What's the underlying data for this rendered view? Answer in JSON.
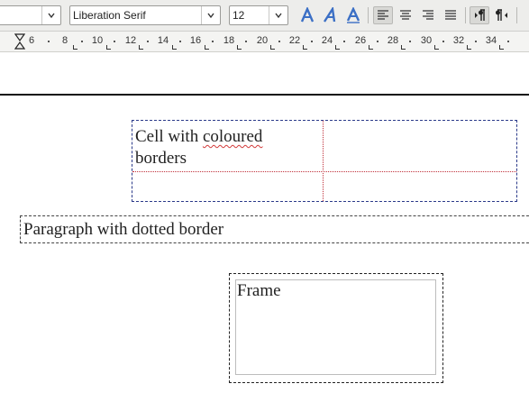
{
  "toolbar": {
    "paragraph_style": "",
    "font_name": "Liberation Serif",
    "font_size": "12",
    "icons": [
      "fontwork-icon",
      "fontwork-alt-icon",
      "fontwork-shadow-icon",
      "align-left-icon",
      "align-center-icon",
      "align-right-icon",
      "justify-icon",
      "ltr-text-direction-icon",
      "rtl-text-direction-icon"
    ],
    "colors": {
      "bg": "#ededeb",
      "icon_blue": "#3b6fc5"
    }
  },
  "ruler": {
    "marks": [
      "6",
      "8",
      "10",
      "12",
      "14",
      "16",
      "18",
      "20",
      "22",
      "24",
      "26",
      "28",
      "30",
      "32",
      "34"
    ]
  },
  "document": {
    "table_cell_text": [
      "Cell with ",
      "coloured",
      " borders"
    ],
    "paragraph_text": "Paragraph with dotted border",
    "frame_text": "Frame",
    "colors": {
      "table_border": "#2b3a8a",
      "cell_divider": "#c0303a",
      "spellcheck": "#d23a3a"
    }
  }
}
